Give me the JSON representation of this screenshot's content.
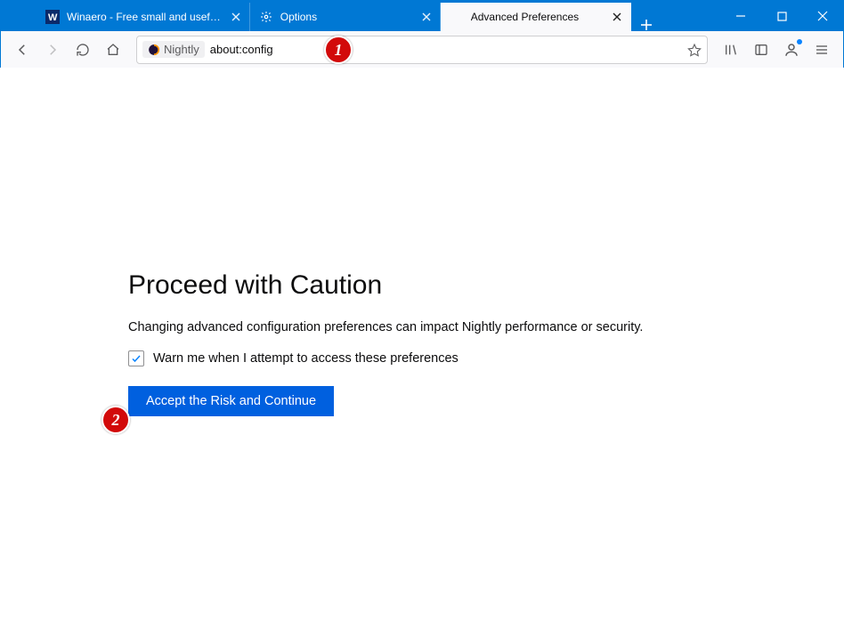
{
  "tabs": [
    {
      "label": "Winaero - Free small and usef…",
      "icon": "winaero-favicon"
    },
    {
      "label": "Options",
      "icon": "gear-icon"
    },
    {
      "label": "Advanced Preferences",
      "icon": "firefox-icon"
    }
  ],
  "urlbar": {
    "identity_label": "Nightly",
    "address": "about:config"
  },
  "page": {
    "heading": "Proceed with Caution",
    "body": "Changing advanced configuration preferences can impact Nightly performance or security.",
    "checkbox_label": "Warn me when I attempt to access these preferences",
    "accept_label": "Accept the Risk and Continue"
  },
  "annotations": {
    "one": "1",
    "two": "2"
  }
}
